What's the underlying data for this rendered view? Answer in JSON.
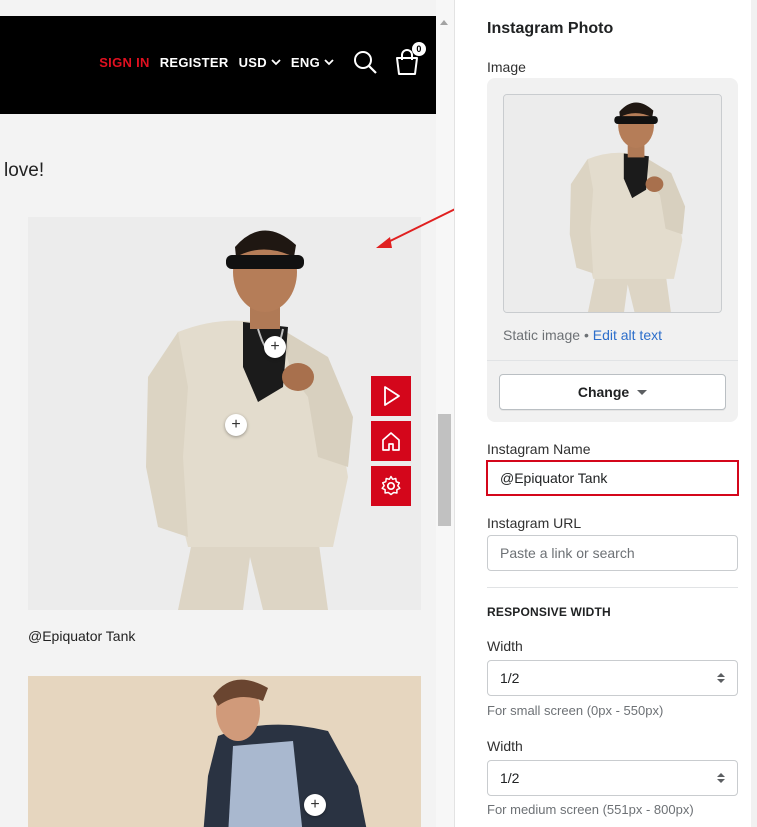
{
  "header": {
    "sign_in": "SIGN IN",
    "register": "REGISTER",
    "currency": "USD",
    "language": "ENG",
    "cart_count": "0"
  },
  "preview": {
    "heading": "love!",
    "caption": "@Epiquator Tank"
  },
  "panel": {
    "title": "Instagram Photo",
    "image_label": "Image",
    "static_image": "Static image",
    "separator_dot": "•",
    "edit_alt_text": "Edit alt text",
    "change_button": "Change",
    "instagram_name_label": "Instagram Name",
    "instagram_name_value": "@Epiquator Tank",
    "instagram_url_label": "Instagram URL",
    "instagram_url_placeholder": "Paste a link or search",
    "responsive_width_heading": "RESPONSIVE WIDTH",
    "width_label_1": "Width",
    "width_value_1": "1/2",
    "small_screen_help": "For small screen (0px - 550px)",
    "width_label_2": "Width",
    "width_value_2": "1/2",
    "medium_screen_help": "For medium screen (551px - 800px)"
  },
  "colors": {
    "accent_red": "#d4061b",
    "sign_in_red": "#e01020",
    "link_blue": "#2c6ecb",
    "topbar_black": "#000000"
  },
  "icons": [
    "chevron-down-icon",
    "search-icon",
    "cart-icon",
    "play-icon",
    "home-icon",
    "gear-icon",
    "plus-icon",
    "caret-down-icon",
    "select-arrows-icon",
    "annotation-arrow"
  ]
}
